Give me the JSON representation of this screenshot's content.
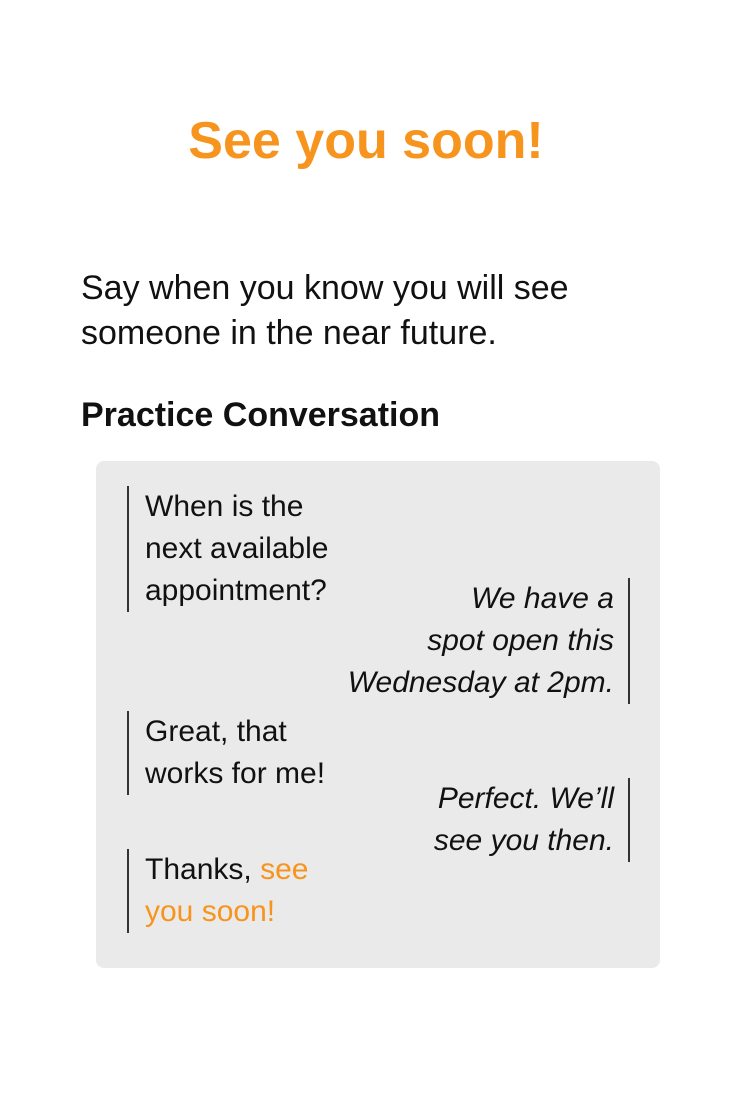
{
  "title": "See you soon!",
  "description": [
    "Say when you know you will see",
    "someone in the near future."
  ],
  "practice_heading": "Practice Conversation",
  "conversation": {
    "msg1": [
      "When is the",
      "next available",
      "appointment?"
    ],
    "msg2": [
      "We have a",
      "spot open this",
      "Wednesday at 2pm."
    ],
    "msg3": [
      "Great, that",
      "works for me!"
    ],
    "msg4": [
      "Perfect. We’ll",
      "see you then."
    ],
    "msg5": {
      "line1_plain": "Thanks, ",
      "line1_highlight": "see",
      "line2_highlight": "you soon!"
    }
  },
  "colors": {
    "accent": "#f7941d",
    "panel_bg": "#eaeaea",
    "text": "#111111"
  }
}
